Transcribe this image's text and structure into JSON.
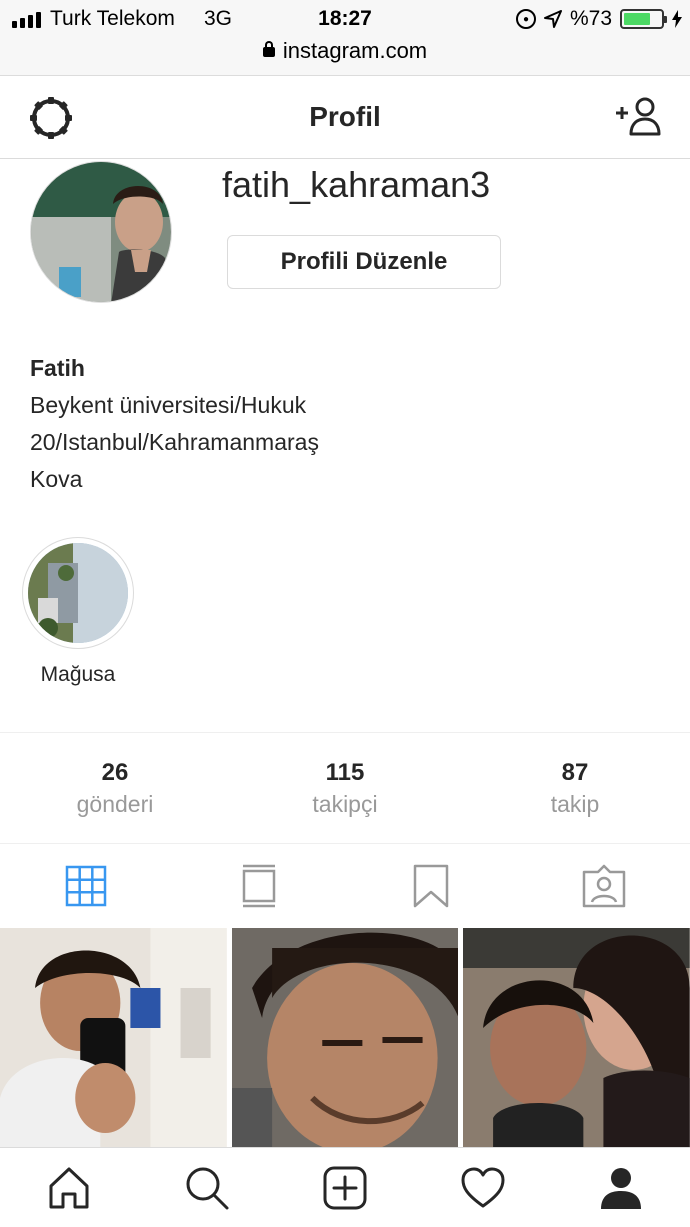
{
  "status_bar": {
    "carrier": "Turk Telekom",
    "network": "3G",
    "time": "18:27",
    "battery": "%73",
    "battery_level": 0.73,
    "url": "instagram.com"
  },
  "header": {
    "title": "Profil",
    "settings_icon": "gear-icon",
    "add_user_icon": "add-user-icon"
  },
  "profile": {
    "username": "fatih_kahraman3",
    "edit_button": "Profili Düzenle",
    "name": "Fatih",
    "bio_lines": [
      "Beykent üniversitesi/Hukuk",
      "20/Istanbul/Kahramanmaraş",
      "Kova"
    ]
  },
  "highlights": [
    {
      "label": "Mağusa"
    }
  ],
  "stats": [
    {
      "value": "26",
      "label": "gönderi"
    },
    {
      "value": "115",
      "label": "takipçi"
    },
    {
      "value": "87",
      "label": "takip"
    }
  ],
  "tabs": [
    "grid-icon",
    "feed-icon",
    "saved-icon",
    "tagged-icon"
  ],
  "bottom_nav": [
    "home-icon",
    "search-icon",
    "new-post-icon",
    "activity-icon",
    "profile-icon"
  ],
  "colors": {
    "active_tab": "#3897f0",
    "inactive_icon": "#999999",
    "battery": "#4cd964"
  }
}
